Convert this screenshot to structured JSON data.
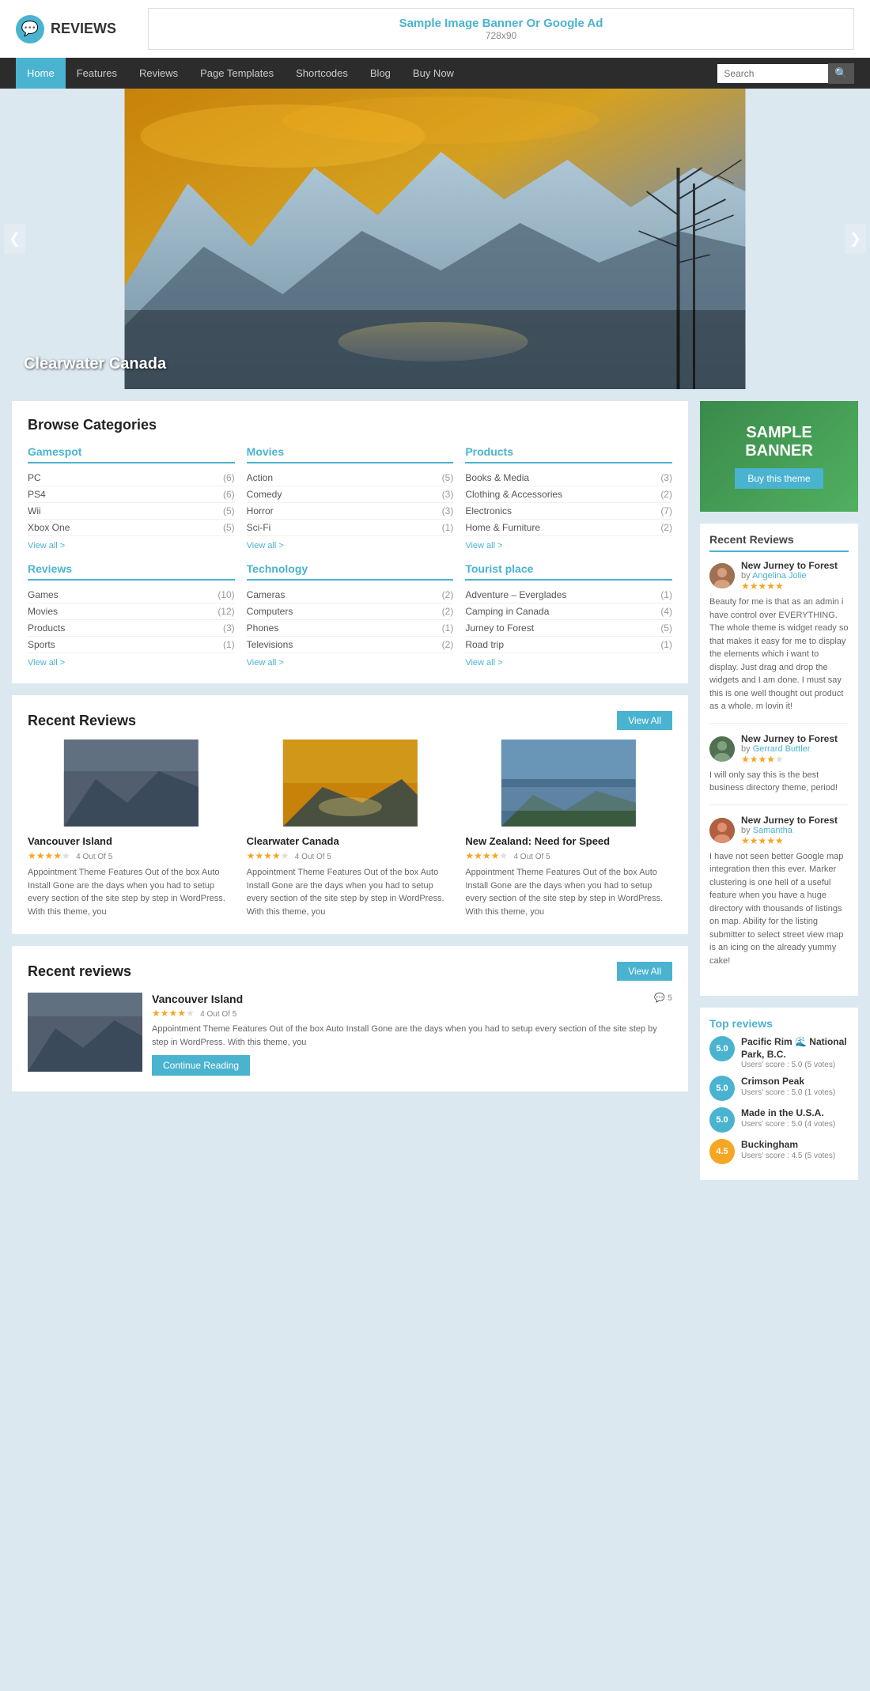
{
  "header": {
    "logo_text": "REVIEWS",
    "logo_icon": "💬",
    "banner_title": "Sample Image Banner Or Google Ad",
    "banner_size": "728x90"
  },
  "nav": {
    "items": [
      {
        "label": "Home",
        "active": true
      },
      {
        "label": "Features",
        "active": false
      },
      {
        "label": "Reviews",
        "active": false
      },
      {
        "label": "Page Templates",
        "active": false
      },
      {
        "label": "Shortcodes",
        "active": false
      },
      {
        "label": "Blog",
        "active": false
      },
      {
        "label": "Buy Now",
        "active": false
      }
    ],
    "search_placeholder": "Search"
  },
  "hero": {
    "caption": "Clearwater Canada",
    "prev_label": "❮",
    "next_label": "❯"
  },
  "browse_categories": {
    "title": "Browse Categories",
    "sections": [
      {
        "id": "gamespot",
        "name": "Gamespot",
        "items": [
          {
            "label": "PC",
            "count": 6
          },
          {
            "label": "PS4",
            "count": 6
          },
          {
            "label": "Wii",
            "count": 5
          },
          {
            "label": "Xbox One",
            "count": 5
          }
        ],
        "view_all": "View all >"
      },
      {
        "id": "movies",
        "name": "Movies",
        "items": [
          {
            "label": "Action",
            "count": 5
          },
          {
            "label": "Comedy",
            "count": 3
          },
          {
            "label": "Horror",
            "count": 3
          },
          {
            "label": "Sci-Fi",
            "count": 1
          }
        ],
        "view_all": "View all >"
      },
      {
        "id": "products",
        "name": "Products",
        "items": [
          {
            "label": "Books & Media",
            "count": 3
          },
          {
            "label": "Clothing & Accessories",
            "count": 2
          },
          {
            "label": "Electronics",
            "count": 7
          },
          {
            "label": "Home & Furniture",
            "count": 2
          }
        ],
        "view_all": "View all >"
      },
      {
        "id": "reviews",
        "name": "Reviews",
        "items": [
          {
            "label": "Games",
            "count": 10
          },
          {
            "label": "Movies",
            "count": 12
          },
          {
            "label": "Products",
            "count": 3
          },
          {
            "label": "Sports",
            "count": 1
          }
        ],
        "view_all": "View all >"
      },
      {
        "id": "technology",
        "name": "Technology",
        "items": [
          {
            "label": "Cameras",
            "count": 2
          },
          {
            "label": "Computers",
            "count": 2
          },
          {
            "label": "Phones",
            "count": 1
          },
          {
            "label": "Televisions",
            "count": 2
          }
        ],
        "view_all": "View all >"
      },
      {
        "id": "tourist_place",
        "name": "Tourist place",
        "items": [
          {
            "label": "Adventure – Everglades",
            "count": 1
          },
          {
            "label": "Camping in Canada",
            "count": 4
          },
          {
            "label": "Jurney to Forest",
            "count": 5
          },
          {
            "label": "Road trip",
            "count": 1
          }
        ],
        "view_all": "View all >"
      }
    ]
  },
  "recent_reviews_grid": {
    "title": "Recent Reviews",
    "view_all": "View All",
    "cards": [
      {
        "title": "Vancouver Island",
        "rating": 4,
        "rating_label": "4 Out Of 5",
        "description": "Appointment Theme Features Out of the box Auto Install Gone are the days when you had to setup every section of the site step by step in WordPress. With this theme, you",
        "img_color": "#607080"
      },
      {
        "title": "Clearwater Canada",
        "rating": 4,
        "rating_label": "4 Out Of 5",
        "description": "Appointment Theme Features Out of the box Auto Install Gone are the days when you had to setup every section of the site step by step in WordPress. With this theme, you",
        "img_color": "#c8820a"
      },
      {
        "title": "New Zealand: Need for Speed",
        "rating": 4,
        "rating_label": "4 Out Of 5",
        "description": "Appointment Theme Features Out of the box Auto Install Gone are the days when you had to setup every section of the site step by step in WordPress. With this theme, you",
        "img_color": "#4a7090"
      }
    ]
  },
  "recent_reviews_list": {
    "title": "Recent reviews",
    "view_all": "View All",
    "items": [
      {
        "title": "Vancouver Island",
        "rating": 4,
        "rating_label": "4 Out Of 5",
        "comment_count": 5,
        "description": "Appointment Theme Features Out of the box Auto Install Gone are the days when you had to setup every section of the site step by step in WordPress. With this theme, you",
        "continue_label": "Continue Reading",
        "img_color": "#607080"
      }
    ]
  },
  "sidebar": {
    "banner": {
      "text": "SAMPLE BANNER",
      "btn_label": "Buy this theme"
    },
    "recent_reviews_title": "Recent Reviews",
    "reviews": [
      {
        "title": "New Jurney to Forest",
        "by_label": "by",
        "author": "Angelina Jolie",
        "rating": 5,
        "text": "Beauty for me is that as an admin i have control over EVERYTHING. The whole theme is widget ready so that makes it easy for me to display the elements which i want to display. Just drag and drop the widgets and I am done. I must say this is one well thought out product as a whole. m lovin it!",
        "avatar_color": "#a07050"
      },
      {
        "title": "New Jurney to Forest",
        "by_label": "by",
        "author": "Gerrard Buttler",
        "rating": 4,
        "text": "I will only say this is the best business directory theme, period!",
        "avatar_color": "#507050"
      },
      {
        "title": "New Jurney to Forest",
        "by_label": "by",
        "author": "Samantha",
        "rating": 5,
        "text": "I have not seen better Google map integration then this ever. Marker clustering is one hell of a useful feature when you have a huge directory with thousands of listings on map. Ability for the listing submitter to select street view map is an icing on the already yummy cake!",
        "avatar_color": "#b06040"
      }
    ],
    "top_reviews_title": "Top reviews",
    "top_reviews": [
      {
        "score": "5.0",
        "title": "Pacific Rim 🌊 National Park, B.C.",
        "meta": "Users' score : 5.0 (5 votes)",
        "color": "#4ab3d0"
      },
      {
        "score": "5.0",
        "title": "Crimson Peak",
        "meta": "Users' score : 5.0 (1 votes)",
        "color": "#4ab3d0"
      },
      {
        "score": "5.0",
        "title": "Made in the U.S.A.",
        "meta": "Users' score : 5.0 (4 votes)",
        "color": "#4ab3d0"
      },
      {
        "score": "4.5",
        "title": "Buckingham",
        "meta": "Users' score : 4.5 (5 votes)",
        "color": "#f5a623"
      }
    ]
  }
}
